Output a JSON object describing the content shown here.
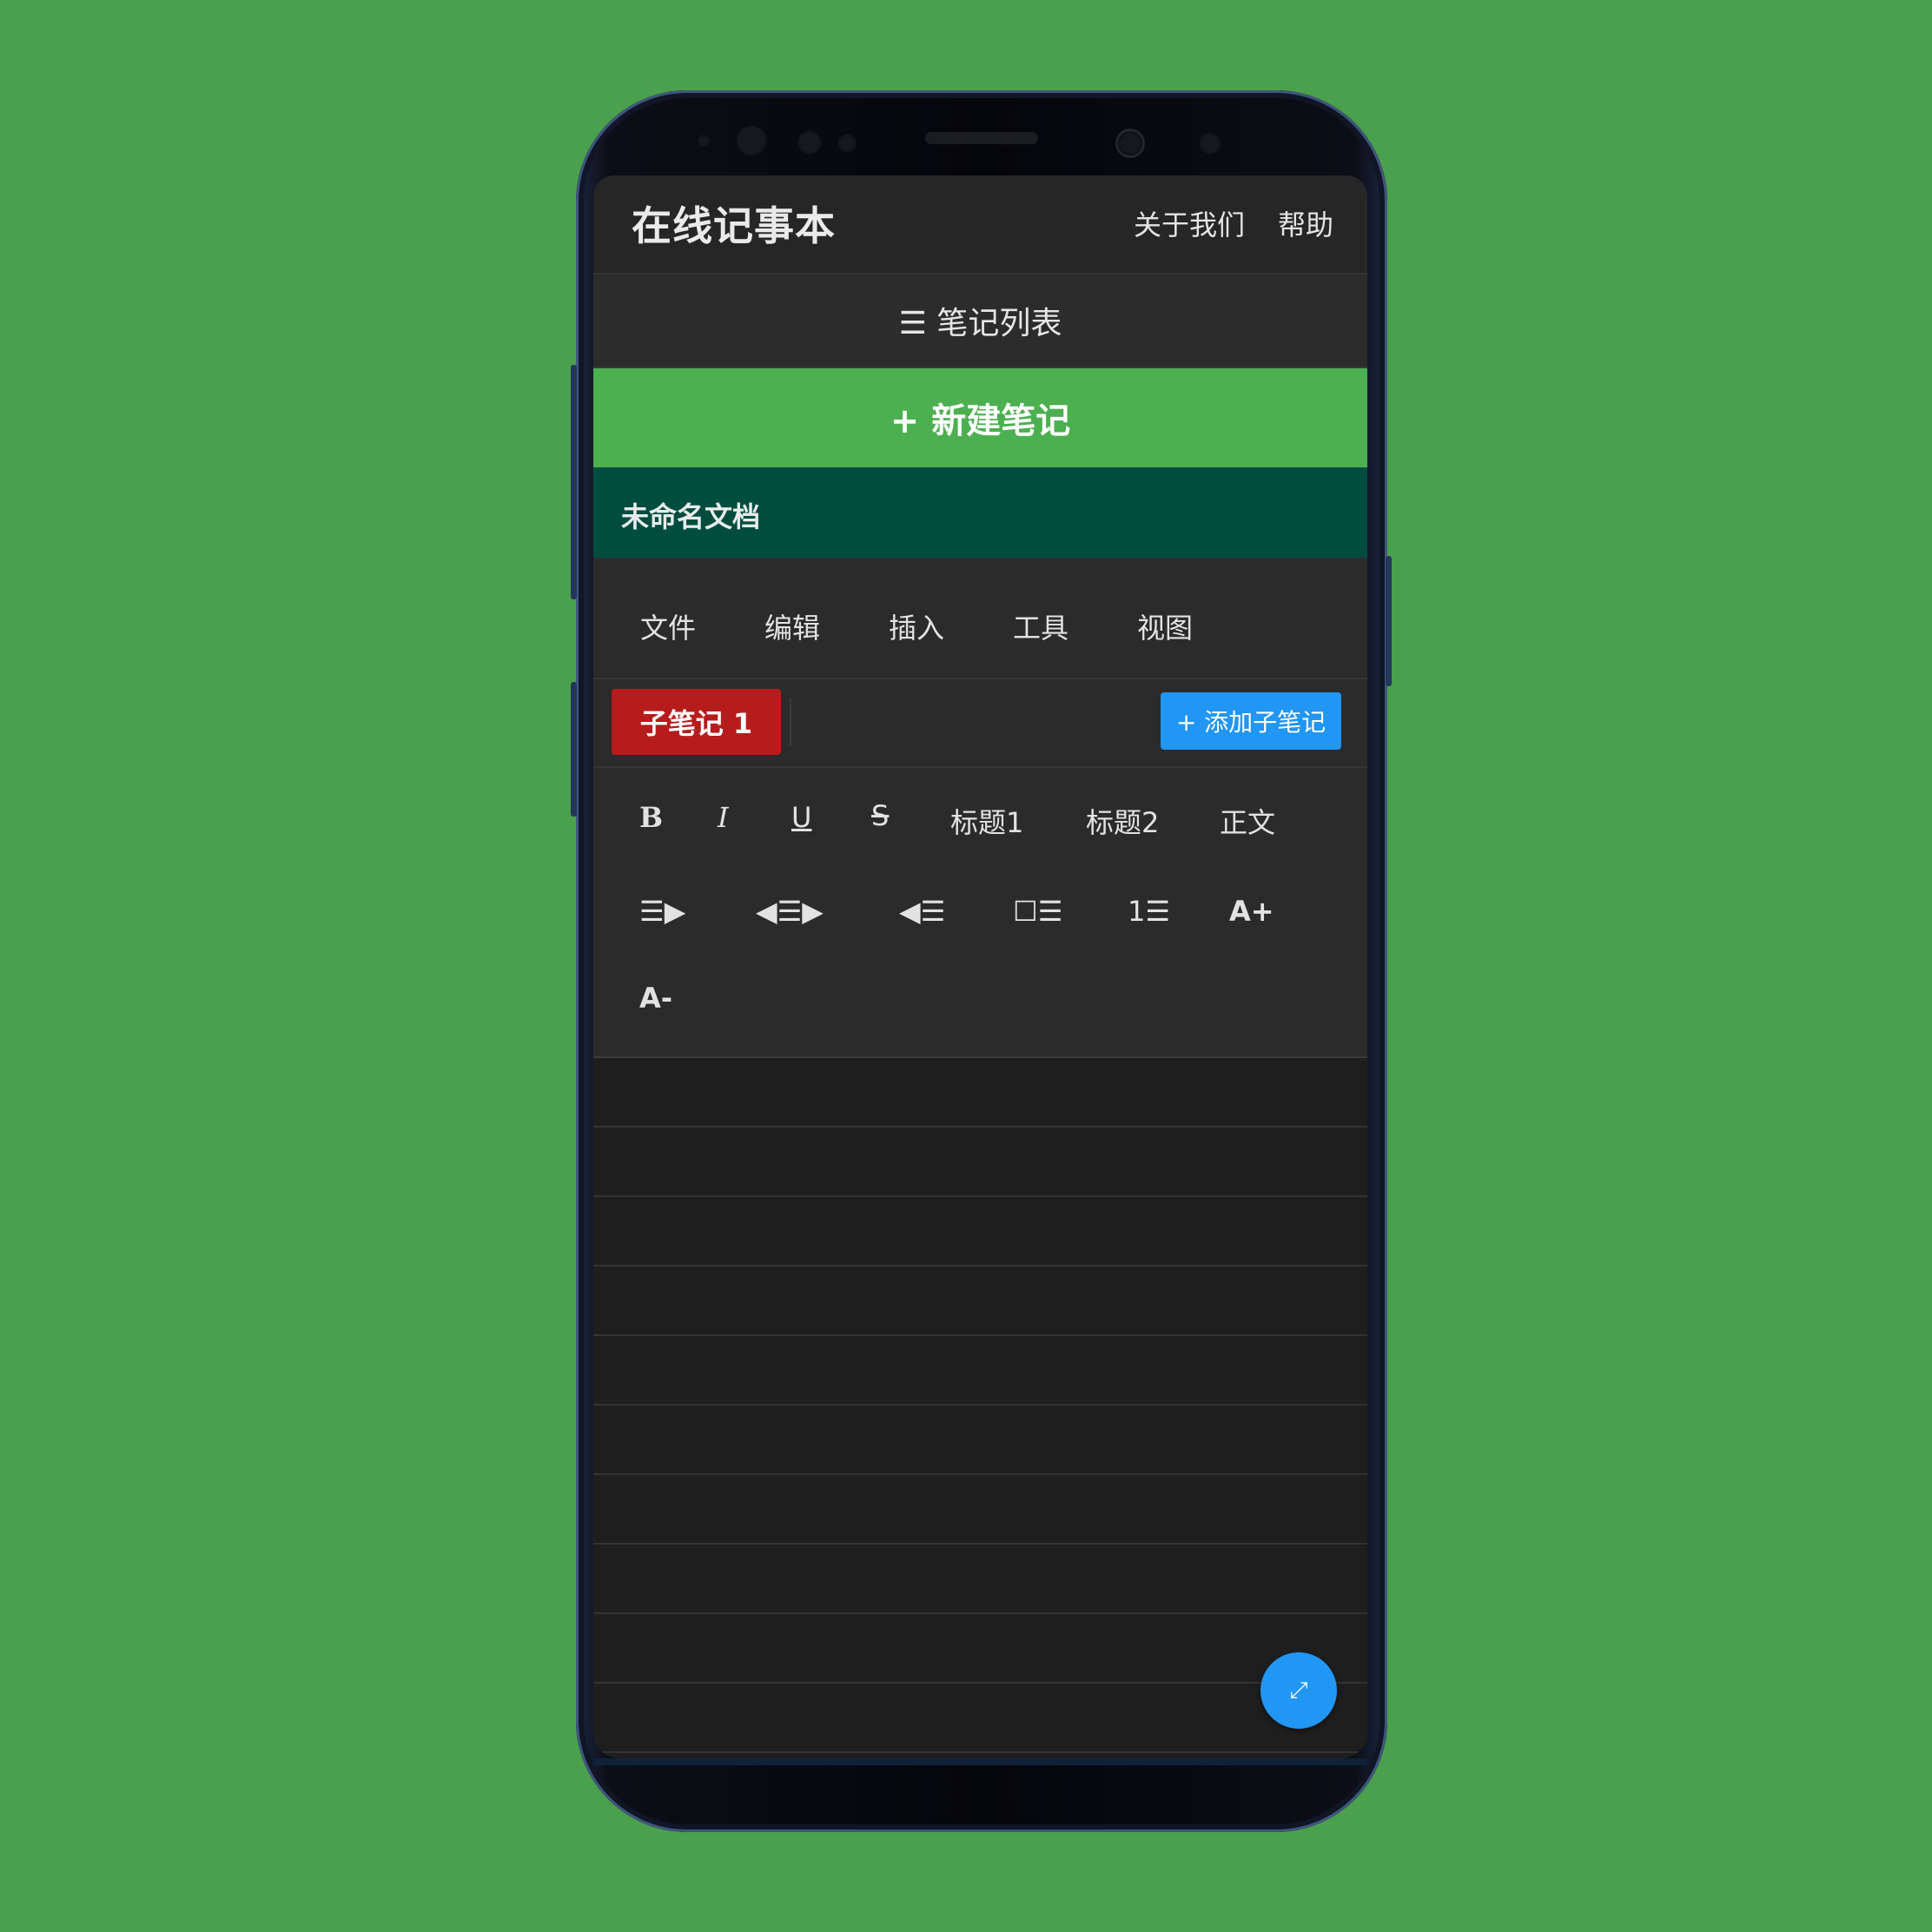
{
  "app": {
    "title": "在线记事本",
    "nav": {
      "about": "关于我们",
      "help": "帮助"
    }
  },
  "notes_list": {
    "label": "☰ 笔记列表"
  },
  "new_note": {
    "label": "+ 新建笔记"
  },
  "document": {
    "title": "未命名文档"
  },
  "menu": {
    "items": [
      "文件",
      "编辑",
      "插入",
      "工具",
      "视图"
    ]
  },
  "subnotes": {
    "active_tab": "子笔记 1",
    "add_label": "+ 添加子笔记"
  },
  "toolbar": {
    "bold": "B",
    "italic": "I",
    "underline": "U",
    "strikethrough": "S",
    "heading1": "标题1",
    "heading2": "标题2",
    "body_text": "正文",
    "align_right": "☰▶",
    "align_center": "◀☰▶",
    "align_left": "◀☰",
    "checklist": "☐☰",
    "ordered_list": "1☰",
    "font_increase": "A+",
    "font_decrease": "A-"
  },
  "fab": {
    "icon": "fullscreen-icon",
    "glyph": "⤢"
  },
  "colors": {
    "background": "#4aa04c",
    "new_note": "#4caf50",
    "doc_title_bar": "#004d40",
    "active_tab": "#b71c1c",
    "accent_blue": "#2196f3"
  }
}
